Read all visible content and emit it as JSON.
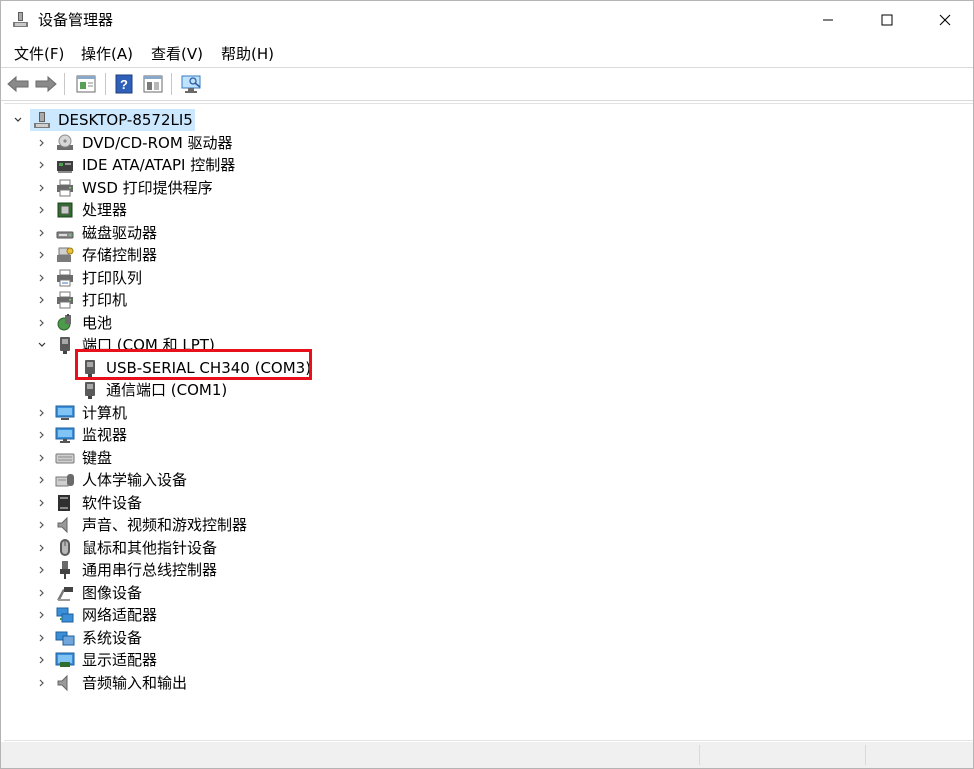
{
  "window": {
    "title": "设备管理器",
    "minimize_label": "",
    "maximize_label": "",
    "close_label": ""
  },
  "menu": [
    {
      "label": "文件(F)"
    },
    {
      "label": "操作(A)"
    },
    {
      "label": "查看(V)"
    },
    {
      "label": "帮助(H)"
    }
  ],
  "toolbar": {
    "icons": [
      "back-arrow-icon",
      "forward-arrow-icon",
      "properties-icon",
      "help-icon",
      "show-hide-icon",
      "scan-hardware-icon"
    ]
  },
  "tree": {
    "root": {
      "label": "DESKTOP-8572LI5",
      "expanded": true
    },
    "categories": [
      {
        "label": "DVD/CD-ROM 驱动器",
        "icon": "dvd-drive-icon"
      },
      {
        "label": "IDE ATA/ATAPI 控制器",
        "icon": "ide-controller-icon"
      },
      {
        "label": "WSD 打印提供程序",
        "icon": "printer-icon"
      },
      {
        "label": "处理器",
        "icon": "processor-icon"
      },
      {
        "label": "磁盘驱动器",
        "icon": "disk-drive-icon"
      },
      {
        "label": "存储控制器",
        "icon": "storage-controller-icon"
      },
      {
        "label": "打印队列",
        "icon": "print-queue-icon"
      },
      {
        "label": "打印机",
        "icon": "printer-icon"
      },
      {
        "label": "电池",
        "icon": "battery-icon"
      },
      {
        "label": "端口 (COM 和 LPT)",
        "icon": "port-icon",
        "expanded": true,
        "children": [
          {
            "label": "USB-SERIAL CH340 (COM3)",
            "icon": "port-icon",
            "highlighted": true
          },
          {
            "label": "通信端口 (COM1)",
            "icon": "port-icon"
          }
        ]
      },
      {
        "label": "计算机",
        "icon": "computer-icon"
      },
      {
        "label": "监视器",
        "icon": "monitor-icon"
      },
      {
        "label": "键盘",
        "icon": "keyboard-icon"
      },
      {
        "label": "人体学输入设备",
        "icon": "hid-icon"
      },
      {
        "label": "软件设备",
        "icon": "software-device-icon"
      },
      {
        "label": "声音、视频和游戏控制器",
        "icon": "speaker-icon"
      },
      {
        "label": "鼠标和其他指针设备",
        "icon": "mouse-icon"
      },
      {
        "label": "通用串行总线控制器",
        "icon": "usb-icon"
      },
      {
        "label": "图像设备",
        "icon": "camera-icon"
      },
      {
        "label": "网络适配器",
        "icon": "network-adapter-icon"
      },
      {
        "label": "系统设备",
        "icon": "system-device-icon"
      },
      {
        "label": "显示适配器",
        "icon": "display-adapter-icon"
      },
      {
        "label": "音频输入和输出",
        "icon": "speaker-icon"
      }
    ]
  },
  "colors": {
    "selection": "#cce8ff",
    "highlight_border": "#e8101a"
  }
}
